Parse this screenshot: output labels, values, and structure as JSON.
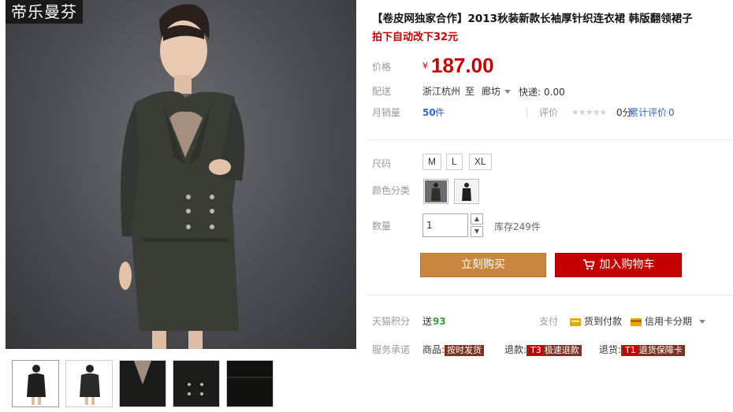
{
  "brand": {
    "logo_text": "帝乐曼芬"
  },
  "product": {
    "title": "【卷皮网独家合作】2013秋装新款长袖厚针织连衣裙 韩版翻领裙子",
    "subtitle": "拍下自动改下32元"
  },
  "price": {
    "label": "价格",
    "currency": "¥",
    "value": "187.00"
  },
  "shipping": {
    "label": "配送",
    "from": "浙江杭州",
    "to_word": "至",
    "to_city": "廊坊",
    "express_label": "快递:",
    "express_fee": "0.00"
  },
  "sales": {
    "label": "月销量",
    "count": "50",
    "unit": "件",
    "rating_label": "评价",
    "stars": "★★★★★",
    "score": "0分",
    "reviews_label": "累计评价",
    "reviews_count": "0"
  },
  "size": {
    "label": "尺码",
    "options": [
      "M",
      "L",
      "XL"
    ]
  },
  "color": {
    "label": "颜色分类",
    "options": [
      "dark-dress-front",
      "dark-dress-side"
    ]
  },
  "quantity": {
    "label": "数量",
    "value": "1",
    "stock_label": "库存249件",
    "up_glyph": "▲",
    "down_glyph": "▼"
  },
  "actions": {
    "buy_now": "立刻购买",
    "add_to_cart": "加入购物车"
  },
  "points": {
    "label": "天猫积分",
    "prefix": "送",
    "value": "93"
  },
  "payment": {
    "label": "支付",
    "cod": "货到付款",
    "credit": "信用卡分期"
  },
  "promise": {
    "label": "服务承诺",
    "items": [
      {
        "prefix": "商品:",
        "badge_prefix": "",
        "badge": "按时发货"
      },
      {
        "prefix": "退款:",
        "badge_prefix": "T3",
        "badge": "极速退款"
      },
      {
        "prefix": "退货:",
        "badge_prefix": "T1",
        "badge": "退货保障卡"
      }
    ]
  },
  "colors": {
    "accent_red": "#c40000",
    "buy_orange": "#c9863e",
    "link_blue": "#3366cc",
    "points_green": "#3a9a3a"
  }
}
